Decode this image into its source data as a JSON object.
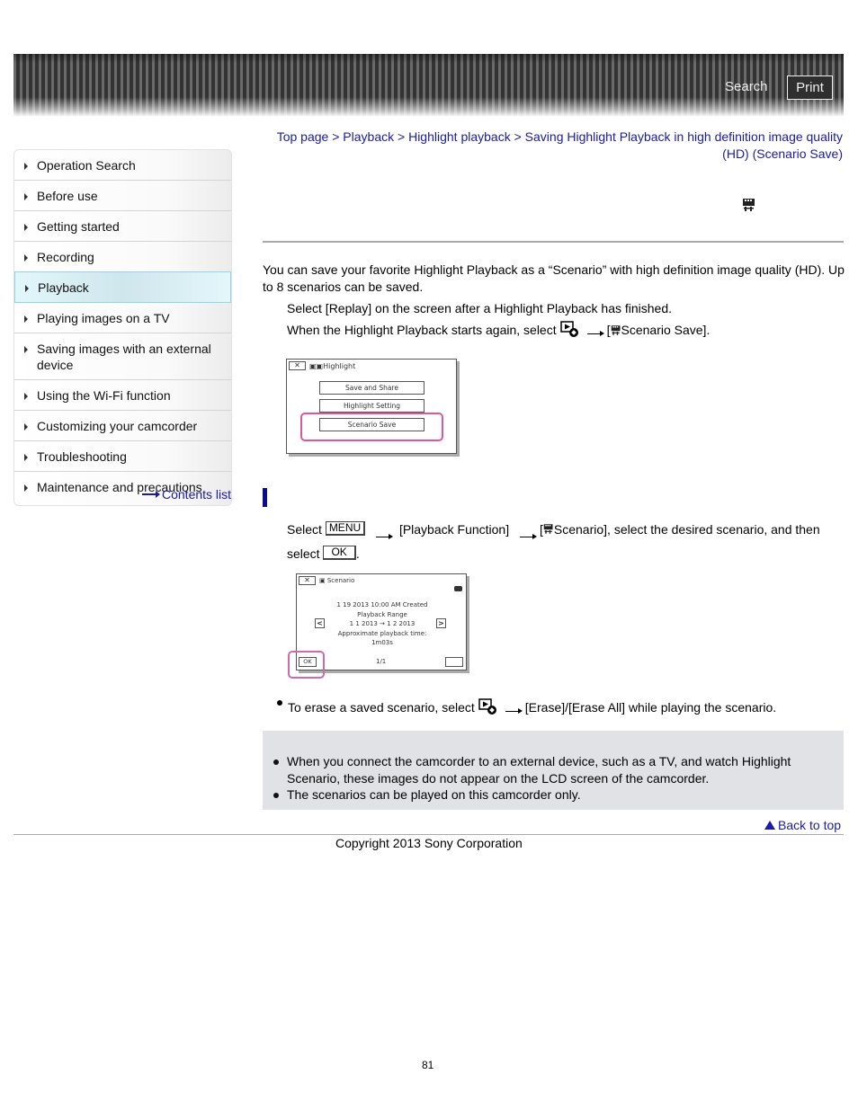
{
  "header": {
    "search_label": "Search",
    "print_label": "Print"
  },
  "sidebar": {
    "items": [
      {
        "label": "Operation Search",
        "active": false
      },
      {
        "label": "Before use",
        "active": false
      },
      {
        "label": "Getting started",
        "active": false
      },
      {
        "label": "Recording",
        "active": false
      },
      {
        "label": "Playback",
        "active": true
      },
      {
        "label": "Playing images on a TV",
        "active": false
      },
      {
        "label": "Saving images with an external device",
        "active": false
      },
      {
        "label": "Using the Wi-Fi function",
        "active": false
      },
      {
        "label": "Customizing your camcorder",
        "active": false
      },
      {
        "label": "Troubleshooting",
        "active": false
      },
      {
        "label": "Maintenance and precautions",
        "active": false
      }
    ],
    "contents_list": "Contents list"
  },
  "breadcrumb": {
    "items": [
      "Top page",
      "Playback",
      "Highlight playback",
      "Saving Highlight Playback in high definition image quality (HD) (Scenario Save)"
    ],
    "separator": ">"
  },
  "content": {
    "intro": "You can save your favorite Highlight Playback as a “Scenario” with high definition image quality (HD). Up to 8 scenarios can be saved.",
    "step1": "Select [Replay] on the screen after a Highlight Playback has finished.",
    "step2_prefix": "When the Highlight Playback starts again, select",
    "step2_suffix": "[",
    "step2_target": "Scenario Save].",
    "screen1": {
      "close": "✕",
      "title": "Highlight",
      "buttons": [
        "Save and Share",
        "Highlight Setting",
        "Scenario Save"
      ],
      "highlighted": "Scenario Save"
    },
    "step3_select": "Select",
    "step3_menu_key": "MENU",
    "step3_function": "[Playback Function]",
    "step3_scenario": "Scenario], select the desired scenario, and then",
    "step3_select2": "select",
    "step3_ok_key": "OK",
    "screen2": {
      "close": "✕",
      "title": "Scenario",
      "created": "1 19 2013  10:00 AM Created",
      "range_label": "Playback Range",
      "range": "1  1 2013 →  1  2 2013",
      "time_label": "Approximate playback time:",
      "time": "1m03s",
      "prev": "<",
      "next": ">",
      "ok": "OK",
      "page": "1/1"
    },
    "erase_note_prefix": "To erase a saved scenario, select",
    "erase_note_suffix": "[Erase]/[Erase All] while playing the scenario."
  },
  "notes": [
    "When you connect the camcorder to an external device, such as a TV, and watch Highlight Scenario, these images do not appear on the LCD screen of the camcorder.",
    "The scenarios can be played on this camcorder only."
  ],
  "footer": {
    "back_to_top": "Back to top",
    "copyright": "Copyright 2013 Sony Corporation",
    "page_number": "81"
  }
}
